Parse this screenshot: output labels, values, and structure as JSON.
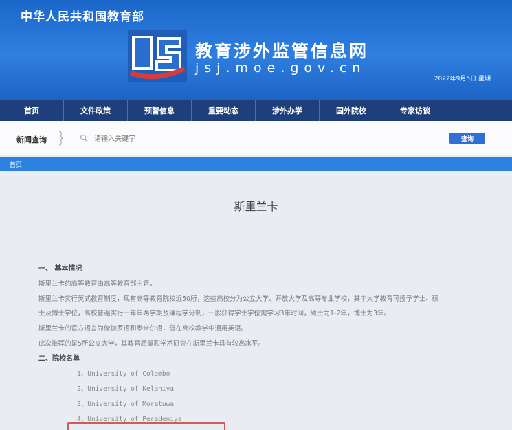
{
  "header": {
    "ministry": "中华人民共和国教育部",
    "site_name": "教育涉外监管信息网",
    "site_domain": "jsj.moe.gov.cn",
    "date": "2022年9月5日 星期一"
  },
  "nav": {
    "items": [
      "首页",
      "文件政策",
      "预警信息",
      "重要动态",
      "涉外办学",
      "国外院校",
      "专家访谈"
    ]
  },
  "search": {
    "label": "新闻查询",
    "placeholder": "请输入关键字",
    "button": "查询"
  },
  "breadcrumb": "首页",
  "article": {
    "title": "斯里兰卡",
    "section1": "一、 基本情况",
    "paragraphs": [
      "斯里兰卡的高等教育由高等教育部主管。",
      "斯里兰卡实行英式教育制度，现有高等教育院校近50所，这些高校分为公立大学、开放大学及高等专业学校，其中大学教育可授予学士、硕",
      "士及博士学位，高校普遍实行一年年两学期及课程学分制，一般获得学士学位需学习3年时间，硕士为1-2年，博士为3年。",
      "斯里兰卡的官方语言为僧伽罗语和泰米尔语，但在高校教学中通用英语。",
      "此次推荐的是5所公立大学，其教育质量和学术研究在斯里兰卡具有较高水平。"
    ],
    "section2": "二、院校名单",
    "universities": [
      "1、University of Colombo",
      "2、University of Kelaniya",
      "3、University of Moratuwa",
      "4、University of Peradeniya"
    ]
  },
  "colors": {
    "banner": "#1a67c9",
    "nav": "#1f3f7a",
    "breadcrumb_bar": "#2d82df",
    "button": "#2f6fd6",
    "highlight_border": "#d15a5a"
  }
}
